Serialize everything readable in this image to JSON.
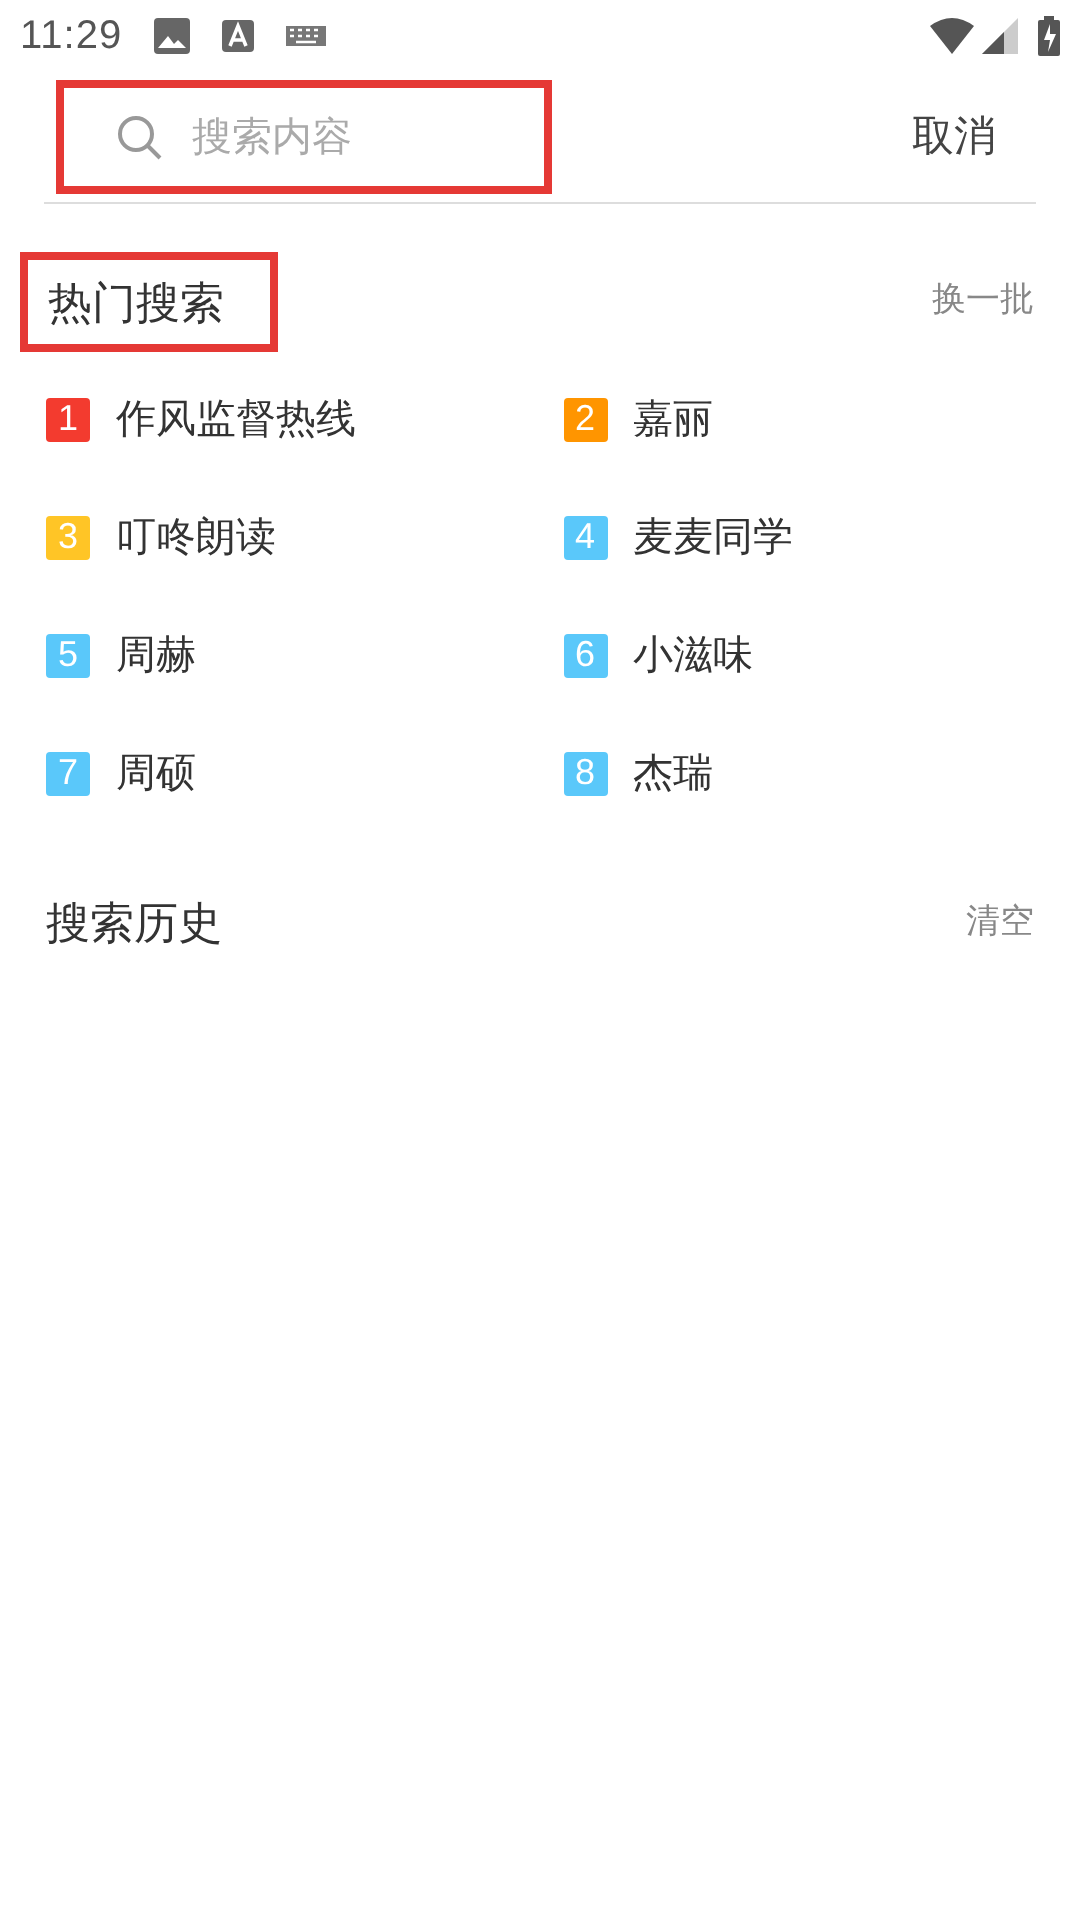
{
  "status_bar": {
    "time": "11:29"
  },
  "search": {
    "placeholder": "搜索内容",
    "highlighted": true,
    "cancel": "取消"
  },
  "hot_search": {
    "title": "热门搜索",
    "highlighted": true,
    "action": "换一批",
    "items": [
      {
        "rank": "1",
        "label": "作风监督热线",
        "color": "#f33b2f"
      },
      {
        "rank": "2",
        "label": "嘉丽",
        "color": "#ff9500"
      },
      {
        "rank": "3",
        "label": "叮咚朗读",
        "color": "#ffc526"
      },
      {
        "rank": "4",
        "label": "麦麦同学",
        "color": "#5ac8fa"
      },
      {
        "rank": "5",
        "label": "周赫",
        "color": "#5ac8fa"
      },
      {
        "rank": "6",
        "label": "小滋味",
        "color": "#5ac8fa"
      },
      {
        "rank": "7",
        "label": "周硕",
        "color": "#5ac8fa"
      },
      {
        "rank": "8",
        "label": "杰瑞",
        "color": "#5ac8fa"
      }
    ]
  },
  "history": {
    "title": "搜索历史",
    "action": "清空"
  }
}
